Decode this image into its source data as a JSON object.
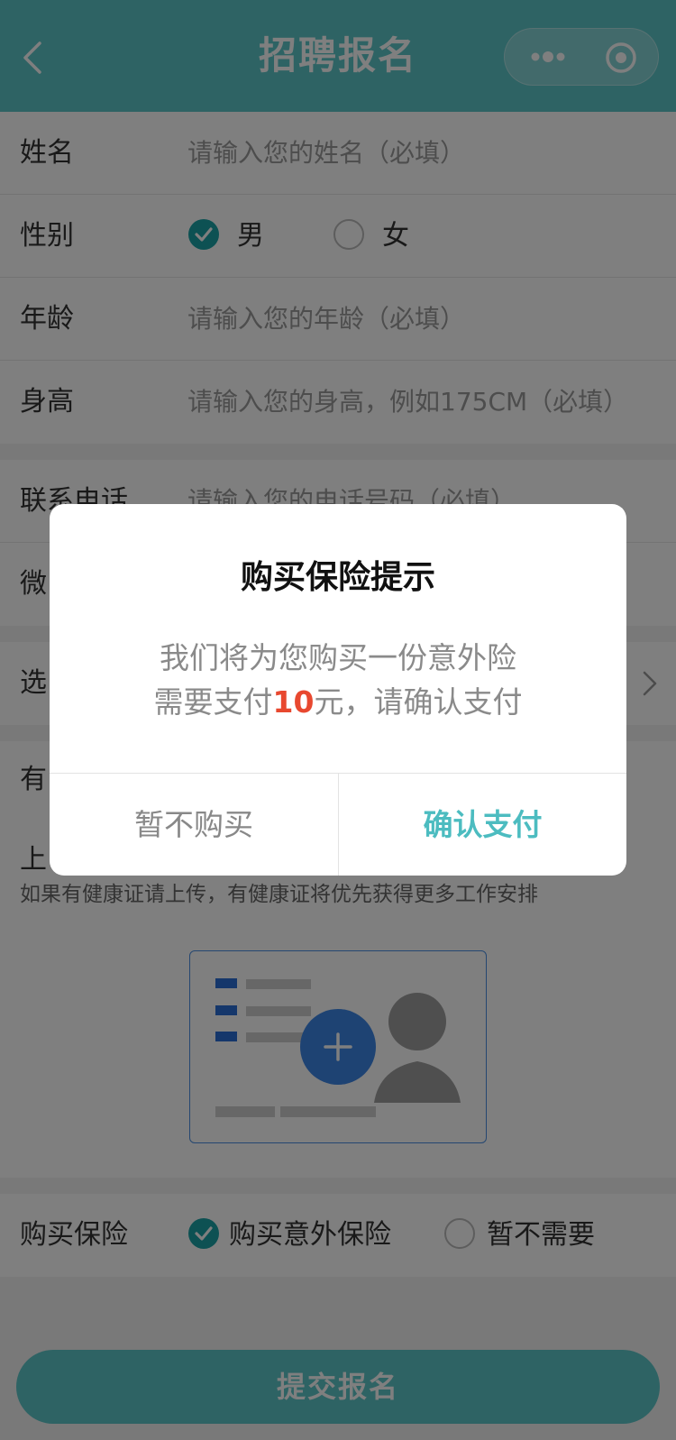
{
  "header": {
    "title": "招聘报名"
  },
  "form": {
    "name": {
      "label": "姓名",
      "placeholder": "请输入您的姓名（必填）"
    },
    "gender": {
      "label": "性别",
      "options": [
        "男",
        "女"
      ],
      "selected": "男"
    },
    "age": {
      "label": "年龄",
      "placeholder": "请输入您的年龄（必填）"
    },
    "height": {
      "label": "身高",
      "placeholder": "请输入您的身高，例如175CM（必填）"
    },
    "phone": {
      "label": "联系电话",
      "placeholder": "请输入您的电话号码（必填）"
    },
    "wechat": {
      "label": "微"
    },
    "select": {
      "label": "选"
    },
    "has": {
      "label": "有"
    },
    "upload": {
      "label": "上",
      "hint": "如果有健康证请上传，有健康证将优先获得更多工作安排"
    },
    "insurance": {
      "label": "购买保险",
      "options": [
        "购买意外保险",
        "暂不需要"
      ],
      "selected": "购买意外保险"
    }
  },
  "submit": {
    "label": "提交报名"
  },
  "modal": {
    "title": "购买保险提示",
    "line1": "我们将为您购买一份意外险",
    "line2_prefix": "需要支付",
    "line2_amount": "10",
    "line2_suffix": "元，请确认支付",
    "cancel_label": "暂不购买",
    "confirm_label": "确认支付"
  },
  "colors": {
    "brand": "#5cc7c9",
    "radio_on": "#1aa3a6",
    "amount": "#e8482f",
    "confirm_text": "#4cbcc0"
  }
}
